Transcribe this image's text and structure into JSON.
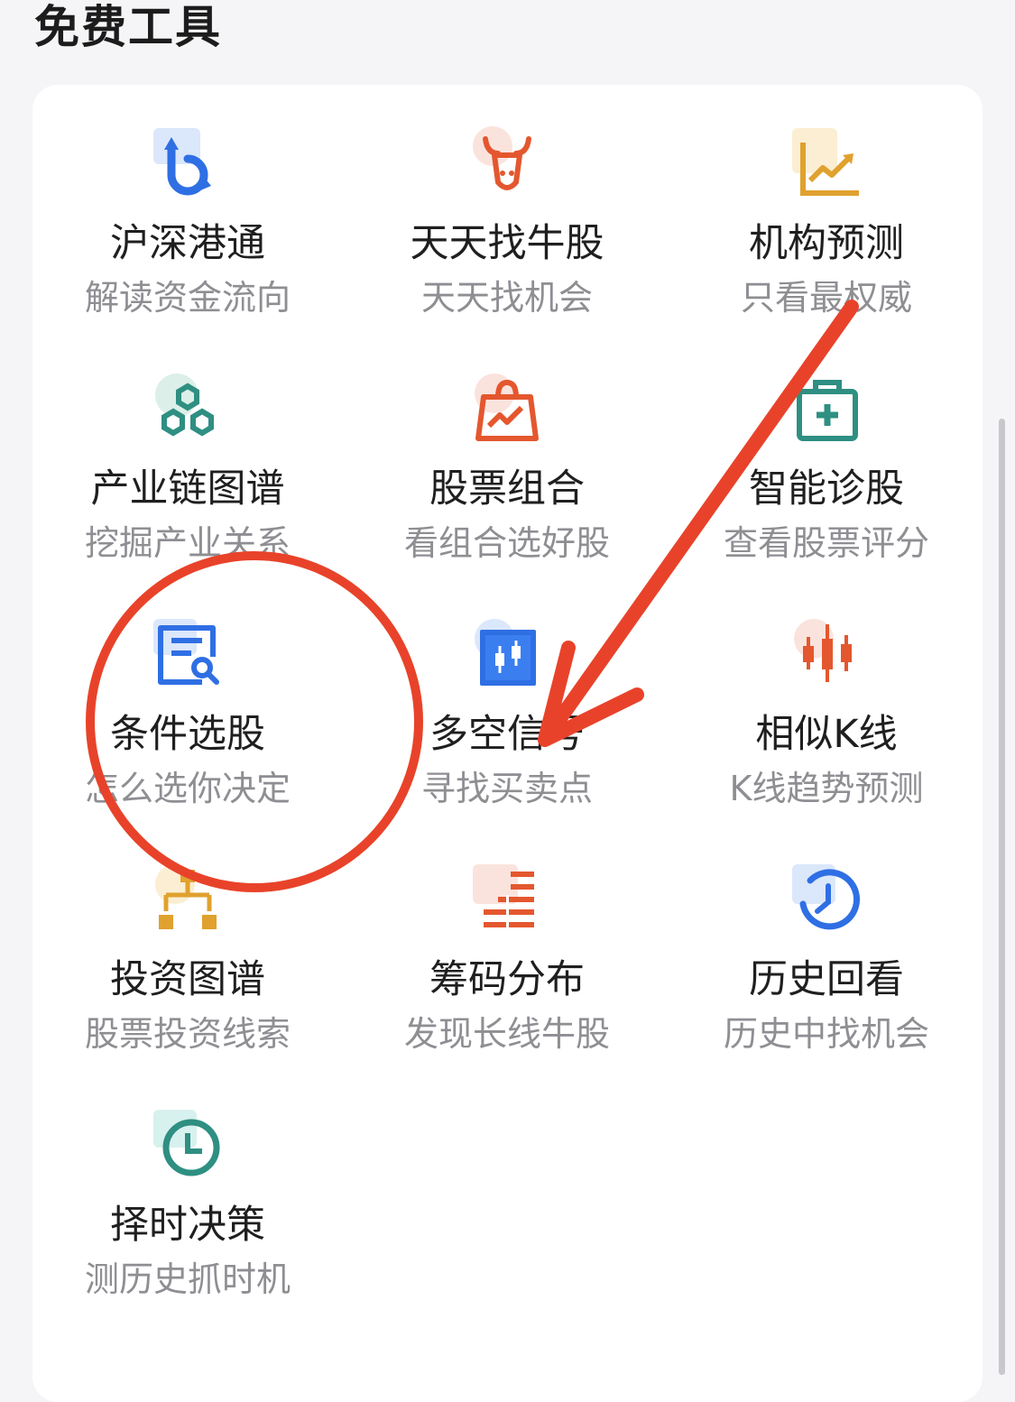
{
  "section": {
    "title": "免费工具"
  },
  "tools": [
    {
      "name": "沪深港通",
      "desc": "解读资金流向",
      "icon": "sync-arrows-icon"
    },
    {
      "name": "天天找牛股",
      "desc": "天天找机会",
      "icon": "bull-head-icon"
    },
    {
      "name": "机构预测",
      "desc": "只看最权威",
      "icon": "trend-chart-icon"
    },
    {
      "name": "产业链图谱",
      "desc": "挖掘产业关系",
      "icon": "hexagon-network-icon"
    },
    {
      "name": "股票组合",
      "desc": "看组合选好股",
      "icon": "bag-chart-icon"
    },
    {
      "name": "智能诊股",
      "desc": "查看股票评分",
      "icon": "medical-kit-icon"
    },
    {
      "name": "条件选股",
      "desc": "怎么选你决定",
      "icon": "document-search-icon"
    },
    {
      "name": "多空信号",
      "desc": "寻找买卖点",
      "icon": "candlestick-box-icon"
    },
    {
      "name": "相似K线",
      "desc": "K线趋势预测",
      "icon": "candlestick-icon"
    },
    {
      "name": "投资图谱",
      "desc": "股票投资线索",
      "icon": "org-tree-icon"
    },
    {
      "name": "筹码分布",
      "desc": "发现长线牛股",
      "icon": "chip-bars-icon"
    },
    {
      "name": "历史回看",
      "desc": "历史中找机会",
      "icon": "history-clock-icon"
    },
    {
      "name": "择时决策",
      "desc": "测历史抓时机",
      "icon": "clock-icon"
    }
  ],
  "annotation": {
    "circle_color": "#e8432a",
    "arrow_color": "#e8432a",
    "highlighted_tool": "条件选股"
  },
  "colors": {
    "blue": "#2f6fe4",
    "orange": "#e4572e",
    "gold": "#e0a12e",
    "teal": "#2e8f82"
  }
}
